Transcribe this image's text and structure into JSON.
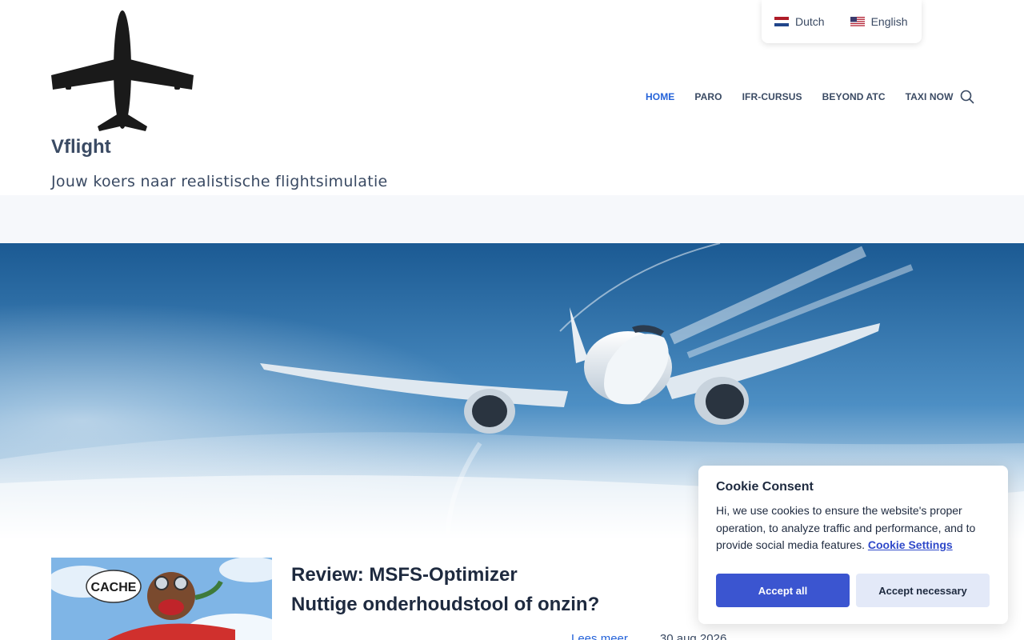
{
  "site": {
    "title": "Vflight",
    "tagline": "Jouw koers naar realistische flightsimulatie"
  },
  "languages": [
    {
      "label": "Dutch",
      "flag": "nl-flag-icon"
    },
    {
      "label": "English",
      "flag": "us-flag-icon"
    }
  ],
  "nav": {
    "items": [
      {
        "label": "HOME",
        "active": true
      },
      {
        "label": "PARO",
        "active": false
      },
      {
        "label": "IFR-CURSUS",
        "active": false
      },
      {
        "label": "BEYOND ATC",
        "active": false
      },
      {
        "label": "TAXI NOW",
        "active": false
      }
    ],
    "search_icon": "search-icon"
  },
  "post": {
    "title_line1": "Review: MSFS-Optimizer",
    "title_line2": "Nuttige onderhoudstool of onzin?",
    "thumb_text": "CACHE",
    "read_more": "Lees meer",
    "date": "30 aug 2026"
  },
  "cookie": {
    "title": "Cookie Consent",
    "text": "Hi, we use cookies to ensure the website's proper operation, to analyze traffic and performance, and to provide social media features.",
    "link": "Cookie Settings",
    "accept_all": "Accept all",
    "accept_necessary": "Accept necessary"
  },
  "colors": {
    "accent": "#2563d9",
    "button": "#3b55d0",
    "text": "#3a4a63"
  }
}
